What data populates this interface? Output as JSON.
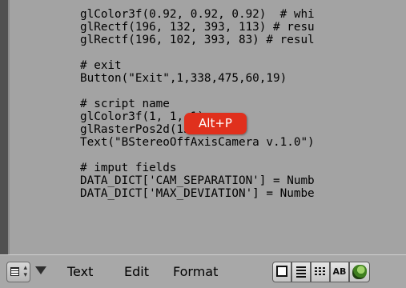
{
  "editor": {
    "code_lines": [
      "glColor3f(0.92, 0.92, 0.92)  # whi",
      "glRectf(196, 132, 393, 113) # resu",
      "glRectf(196, 102, 393, 83) # resul",
      "",
      "# exit",
      "Button(\"Exit\",1,338,475,60,19)",
      "",
      "# script name",
      "glColor3f(1, 1, 1)",
      "glRasterPos2d(15, 479)",
      "Text(\"BStereoOffAxisCamera v.1.0\")",
      "",
      "# imput fields",
      "DATA_DICT['CAM_SEPARATION'] = Numb",
      "DATA_DICT['MAX_DEVIATION'] = Numbe"
    ]
  },
  "tooltip": {
    "text": "Alt+P"
  },
  "header": {
    "editor_type_icon": "text-editor-icon",
    "menus": {
      "text": "Text",
      "edit": "Edit",
      "format": "Format"
    },
    "toolbar": {
      "ab_label": "AB"
    }
  },
  "colors": {
    "editor_bg": "#a3a3a3",
    "tooltip_bg": "#e0301d",
    "header_bg": "#a8a8a8"
  }
}
